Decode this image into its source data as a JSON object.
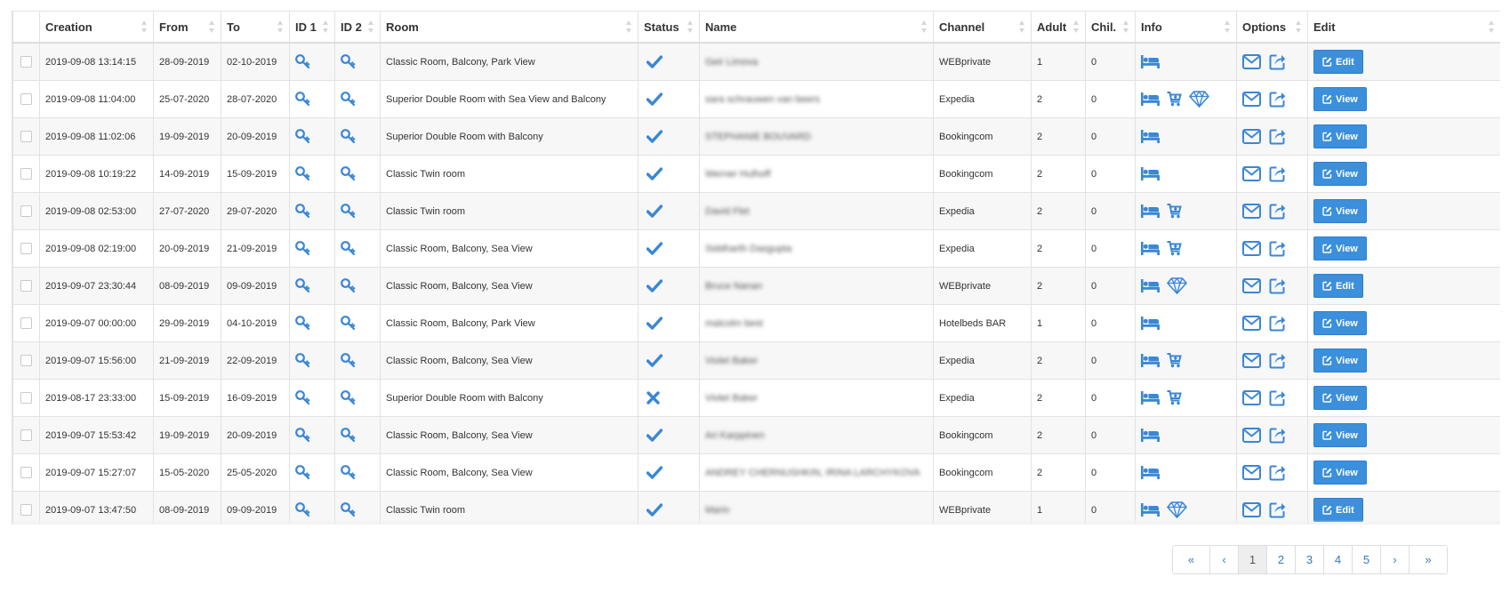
{
  "columns": [
    "",
    "Creation",
    "From",
    "To",
    "ID 1",
    "ID 2",
    "Room",
    "Status",
    "Name",
    "Channel",
    "Adult",
    "Chil.",
    "Info",
    "Options",
    "Edit"
  ],
  "rows": [
    {
      "creation": "2019-09-08 13:14:15",
      "from": "28-09-2019",
      "to": "02-10-2019",
      "room": "Classic Room, Balcony, Park View",
      "status": "confirmed",
      "name": "Geir Limova",
      "channel": "WEBprivate",
      "adult": "1",
      "children": "0",
      "info": [
        "bed-icon"
      ],
      "edit": "Edit"
    },
    {
      "creation": "2019-09-08 11:04:00",
      "from": "25-07-2020",
      "to": "28-07-2020",
      "room": "Superior Double Room with Sea View and Balcony",
      "status": "confirmed",
      "name": "sara schrauwen van beers",
      "channel": "Expedia",
      "adult": "2",
      "children": "0",
      "info": [
        "bed-icon",
        "cart-icon",
        "diamond-icon"
      ],
      "edit": "View"
    },
    {
      "creation": "2019-09-08 11:02:06",
      "from": "19-09-2019",
      "to": "20-09-2019",
      "room": "Superior Double Room with Balcony",
      "status": "confirmed",
      "name": "STEPHANIE BOUVARD",
      "channel": "Bookingcom",
      "adult": "2",
      "children": "0",
      "info": [
        "bed-icon"
      ],
      "edit": "View"
    },
    {
      "creation": "2019-09-08 10:19:22",
      "from": "14-09-2019",
      "to": "15-09-2019",
      "room": "Classic Twin room",
      "status": "confirmed",
      "name": "Werner Hulhoff",
      "channel": "Bookingcom",
      "adult": "2",
      "children": "0",
      "info": [
        "bed-icon"
      ],
      "edit": "View"
    },
    {
      "creation": "2019-09-08 02:53:00",
      "from": "27-07-2020",
      "to": "29-07-2020",
      "room": "Classic Twin room",
      "status": "confirmed",
      "name": "David Flet",
      "channel": "Expedia",
      "adult": "2",
      "children": "0",
      "info": [
        "bed-icon",
        "cart-icon"
      ],
      "edit": "View"
    },
    {
      "creation": "2019-09-08 02:19:00",
      "from": "20-09-2019",
      "to": "21-09-2019",
      "room": "Classic Room, Balcony, Sea View",
      "status": "confirmed",
      "name": "Siddharth Dasgupta",
      "channel": "Expedia",
      "adult": "2",
      "children": "0",
      "info": [
        "bed-icon",
        "cart-icon"
      ],
      "edit": "View"
    },
    {
      "creation": "2019-09-07 23:30:44",
      "from": "08-09-2019",
      "to": "09-09-2019",
      "room": "Classic Room, Balcony, Sea View",
      "status": "confirmed",
      "name": "Bruce Nanan",
      "channel": "WEBprivate",
      "adult": "2",
      "children": "0",
      "info": [
        "bed-icon",
        "diamond-icon"
      ],
      "edit": "Edit"
    },
    {
      "creation": "2019-09-07 00:00:00",
      "from": "29-09-2019",
      "to": "04-10-2019",
      "room": "Classic Room, Balcony, Park View",
      "status": "confirmed",
      "name": "malcolm best",
      "channel": "Hotelbeds BAR",
      "adult": "1",
      "children": "0",
      "info": [
        "bed-icon"
      ],
      "edit": "View"
    },
    {
      "creation": "2019-09-07 15:56:00",
      "from": "21-09-2019",
      "to": "22-09-2019",
      "room": "Classic Room, Balcony, Sea View",
      "status": "confirmed",
      "name": "Violet Baker",
      "channel": "Expedia",
      "adult": "2",
      "children": "0",
      "info": [
        "bed-icon",
        "cart-icon"
      ],
      "edit": "View"
    },
    {
      "creation": "2019-08-17 23:33:00",
      "from": "15-09-2019",
      "to": "16-09-2019",
      "room": "Superior Double Room with Balcony",
      "status": "cancelled",
      "name": "Violet Baker",
      "channel": "Expedia",
      "adult": "2",
      "children": "0",
      "info": [
        "bed-icon",
        "cart-icon"
      ],
      "edit": "View"
    },
    {
      "creation": "2019-09-07 15:53:42",
      "from": "19-09-2019",
      "to": "20-09-2019",
      "room": "Classic Room, Balcony, Sea View",
      "status": "confirmed",
      "name": "Ari Karppinen",
      "channel": "Bookingcom",
      "adult": "2",
      "children": "0",
      "info": [
        "bed-icon"
      ],
      "edit": "View"
    },
    {
      "creation": "2019-09-07 15:27:07",
      "from": "15-05-2020",
      "to": "25-05-2020",
      "room": "Classic Room, Balcony, Sea View",
      "status": "confirmed",
      "name": "ANDREY CHERNUSHKIN, IRINA LARCHYKOVA",
      "channel": "Bookingcom",
      "adult": "2",
      "children": "0",
      "info": [
        "bed-icon"
      ],
      "edit": "View"
    },
    {
      "creation": "2019-09-07 13:47:50",
      "from": "08-09-2019",
      "to": "09-09-2019",
      "room": "Classic Twin room",
      "status": "confirmed",
      "name": "Marin",
      "channel": "WEBprivate",
      "adult": "1",
      "children": "0",
      "info": [
        "bed-icon",
        "diamond-icon"
      ],
      "edit": "Edit"
    }
  ],
  "options_icons": [
    "mail-icon",
    "share-icon"
  ],
  "id_icons": [
    "key-icon",
    "key-icon"
  ],
  "pagination": {
    "first": "«",
    "prev": "‹",
    "pages": [
      "1",
      "2",
      "3",
      "4",
      "5"
    ],
    "active": "1",
    "next": "›",
    "last": "»"
  },
  "colors": {
    "accent": "#3b8fdc",
    "icon": "#3a87d6",
    "row_stripe": "#f7f7f7",
    "border": "#e2e2e2"
  }
}
